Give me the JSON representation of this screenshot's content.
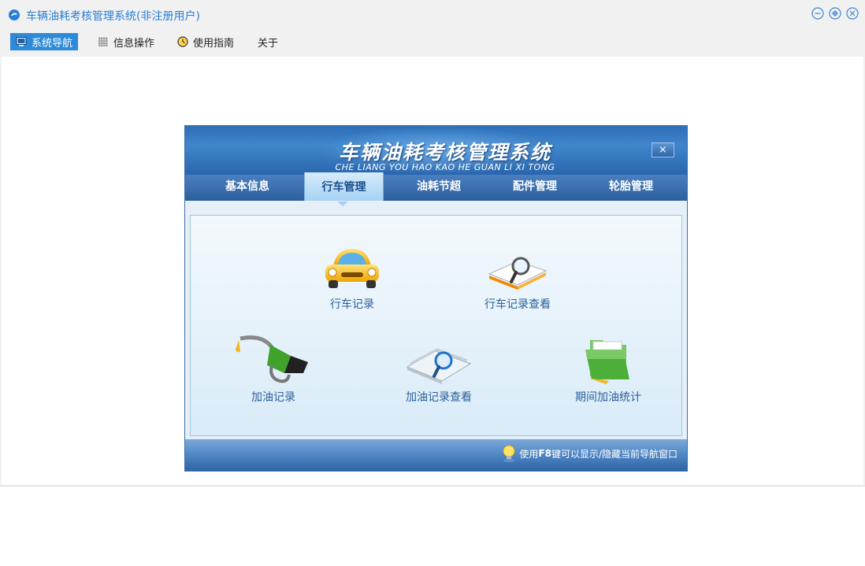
{
  "window": {
    "title": "车辆油耗考核管理系统(非注册用户)",
    "controls": [
      "minimize-icon",
      "restore-icon",
      "close-icon"
    ]
  },
  "menu": [
    {
      "label": "系统导航",
      "icon": "monitor-icon",
      "active": true
    },
    {
      "label": "信息操作",
      "icon": "grid-icon",
      "active": false
    },
    {
      "label": "使用指南",
      "icon": "clock-icon",
      "active": false
    },
    {
      "label": "关于",
      "icon": "",
      "active": false
    }
  ],
  "panel": {
    "title": "车辆油耗考核管理系统",
    "subtitle": "CHE LIANG YOU HAO KAO HE  GUAN  LI XI TONG",
    "close_label": "×",
    "tabs": [
      "基本信息",
      "行车管理",
      "油耗节超",
      "配件管理",
      "轮胎管理"
    ],
    "active_tab": "行车管理",
    "features": [
      {
        "label": "行车记录",
        "icon": "car-icon"
      },
      {
        "label": "行车记录查看",
        "icon": "magnifier-book-icon"
      },
      {
        "label": "加油记录",
        "icon": "fuel-nozzle-icon"
      },
      {
        "label": "加油记录查看",
        "icon": "magnifier-papers-icon"
      },
      {
        "label": "期间加油统计",
        "icon": "folder-icon"
      }
    ],
    "footer_tip_prefix": "使用",
    "footer_tip_key": "F8",
    "footer_tip_suffix": "键可以显示/隐藏当前导航窗口"
  },
  "colors": {
    "accent": "#2d8ad8",
    "title_text": "#2a7fd4",
    "panel_blue": "#2d6eb8"
  }
}
